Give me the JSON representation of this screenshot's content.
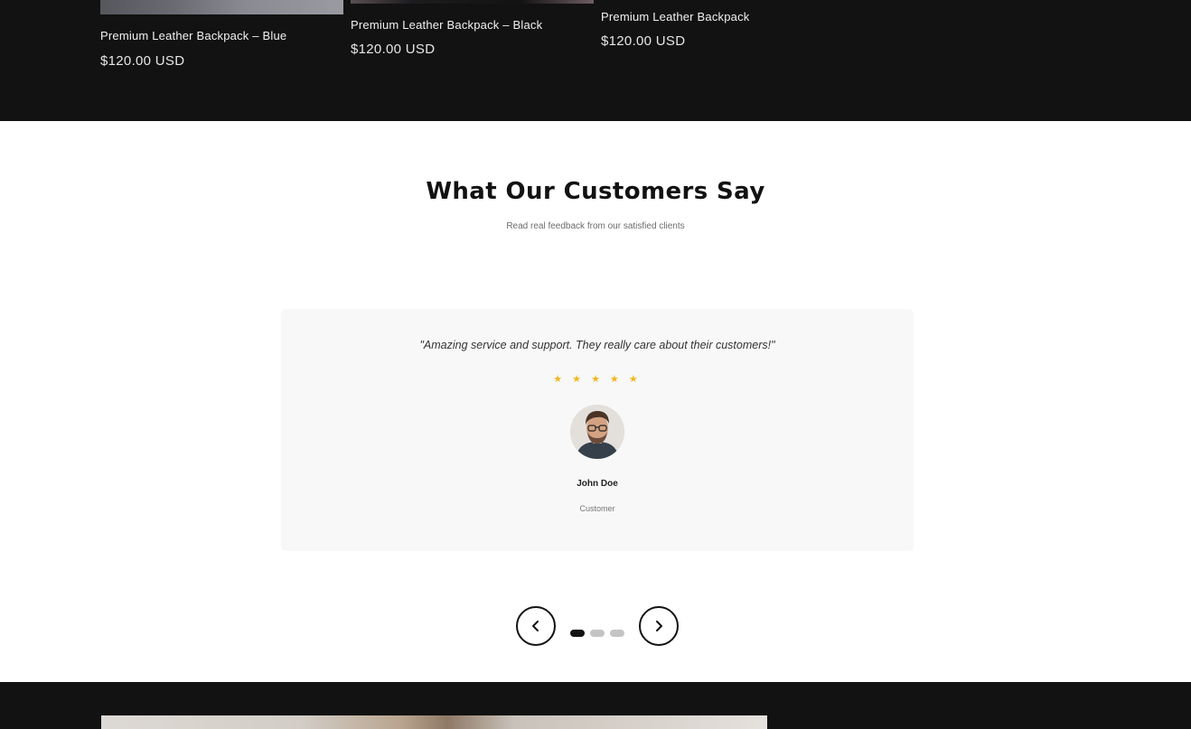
{
  "products": [
    {
      "title": "Premium Leather Backpack – Blue",
      "price": "$120.00 USD"
    },
    {
      "title": "Premium Leather Backpack – Black",
      "price": "$120.00 USD"
    },
    {
      "title": "Premium Leather Backpack",
      "price": "$120.00 USD"
    }
  ],
  "testimonials": {
    "heading": "What Our Customers Say",
    "subheading": "Read real feedback from our satisfied clients",
    "current": {
      "quote": "\"Amazing service and support. They really care about their customers!\"",
      "stars": "★ ★ ★ ★ ★",
      "rating": 5,
      "author_name": "John Doe",
      "author_role": "Customer"
    },
    "slide_count": 3,
    "active_slide": 1
  },
  "colors": {
    "dark_background": "#121212",
    "star": "#f3b61f",
    "card_background": "#f8f8f8",
    "dot_active": "#121212",
    "dot_inactive": "#c4c4c4"
  },
  "icons": {
    "prev": "chevron-left-icon",
    "next": "chevron-right-icon"
  }
}
